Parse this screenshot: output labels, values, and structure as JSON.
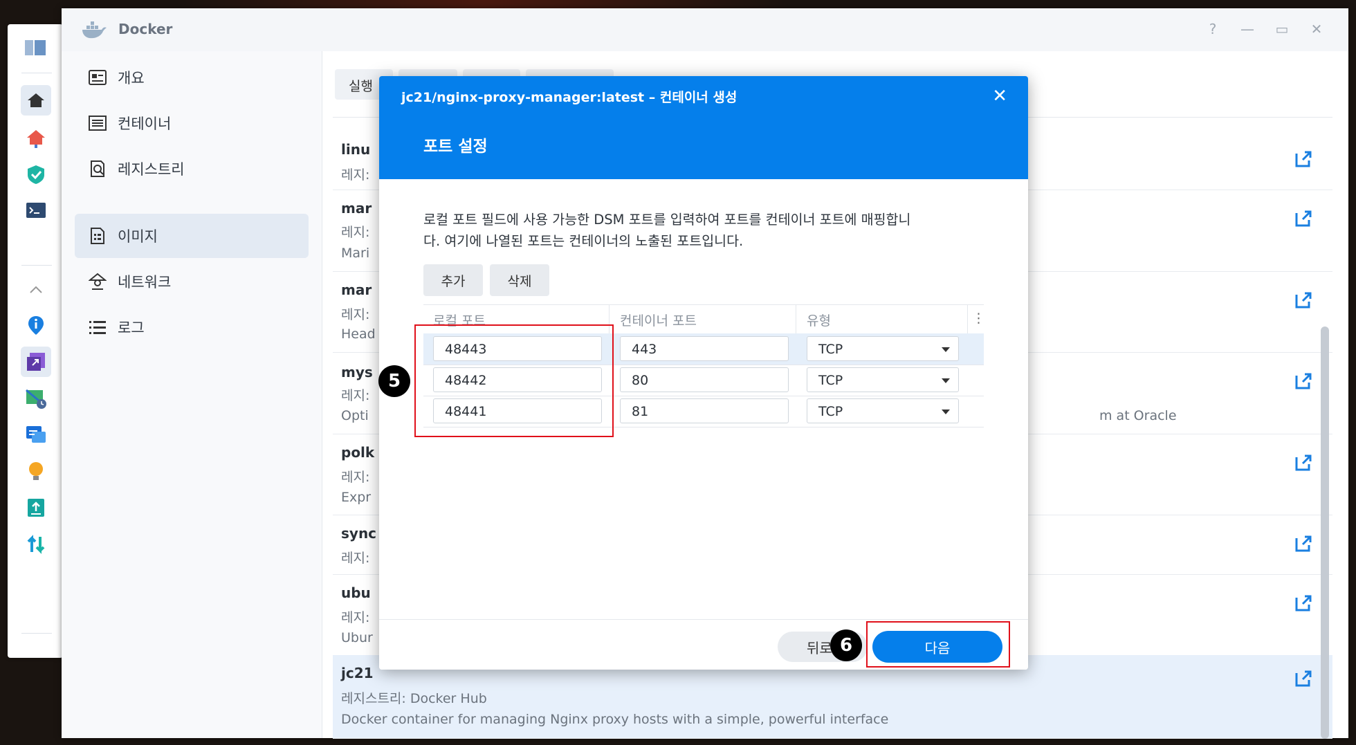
{
  "window": {
    "title": "Docker",
    "controls": [
      "?",
      "—",
      "▭",
      "✕"
    ]
  },
  "nav": {
    "items": [
      {
        "label": "개요",
        "icon": "overview-icon"
      },
      {
        "label": "컨테이너",
        "icon": "container-icon"
      },
      {
        "label": "레지스트리",
        "icon": "registry-icon"
      },
      {
        "label": "이미지",
        "icon": "image-icon",
        "active": true
      },
      {
        "label": "네트워크",
        "icon": "network-icon"
      },
      {
        "label": "로그",
        "icon": "log-icon"
      }
    ]
  },
  "content": {
    "tab_partial": "실행",
    "rows": [
      {
        "name": "linu",
        "sub1": "레지:",
        "sub2": ""
      },
      {
        "name": "mar",
        "sub1": "레지:",
        "sub2": "Mari"
      },
      {
        "name": "mar",
        "sub1": "레지:",
        "sub2": "Head"
      },
      {
        "name": "mys",
        "sub1": "레지:",
        "sub2": "Opti",
        "tail": "m at Oracle"
      },
      {
        "name": "polk",
        "sub1": "레지:",
        "sub2": "Expr"
      },
      {
        "name": "sync",
        "sub1": "레지:",
        "sub2": ""
      },
      {
        "name": "ubu",
        "sub1": "레지:",
        "sub2": "Ubur"
      },
      {
        "name": "jc21",
        "sub1": "레지스트리: Docker Hub",
        "sub2": "Docker container for managing Nginx proxy hosts with a simple, powerful interface"
      }
    ]
  },
  "dialog": {
    "title": "jc21/nginx-proxy-manager:latest – 컨테이너 생성",
    "close": "✕",
    "section": "포트 설정",
    "desc_line1": "로컬 포트 필드에 사용 가능한 DSM 포트를 입력하여 포트를 컨테이너 포트에 매핑합니",
    "desc_line2": "다. 여기에 나열된 포트는 컨테이너의 노출된 포트입니다.",
    "add_label": "추가",
    "delete_label": "삭제",
    "columns": {
      "local": "로컬 포트",
      "container": "컨테이너 포트",
      "type": "유형",
      "more": "⋮"
    },
    "ports": [
      {
        "local": "48443",
        "container": "443",
        "type": "TCP"
      },
      {
        "local": "48442",
        "container": "80",
        "type": "TCP"
      },
      {
        "local": "48441",
        "container": "81",
        "type": "TCP"
      }
    ],
    "back_label": "뒤로",
    "next_label": "다음"
  },
  "annotations": {
    "step5": "5",
    "step6": "6"
  },
  "colors": {
    "accent": "#057feb",
    "highlight": "#e0101a"
  }
}
